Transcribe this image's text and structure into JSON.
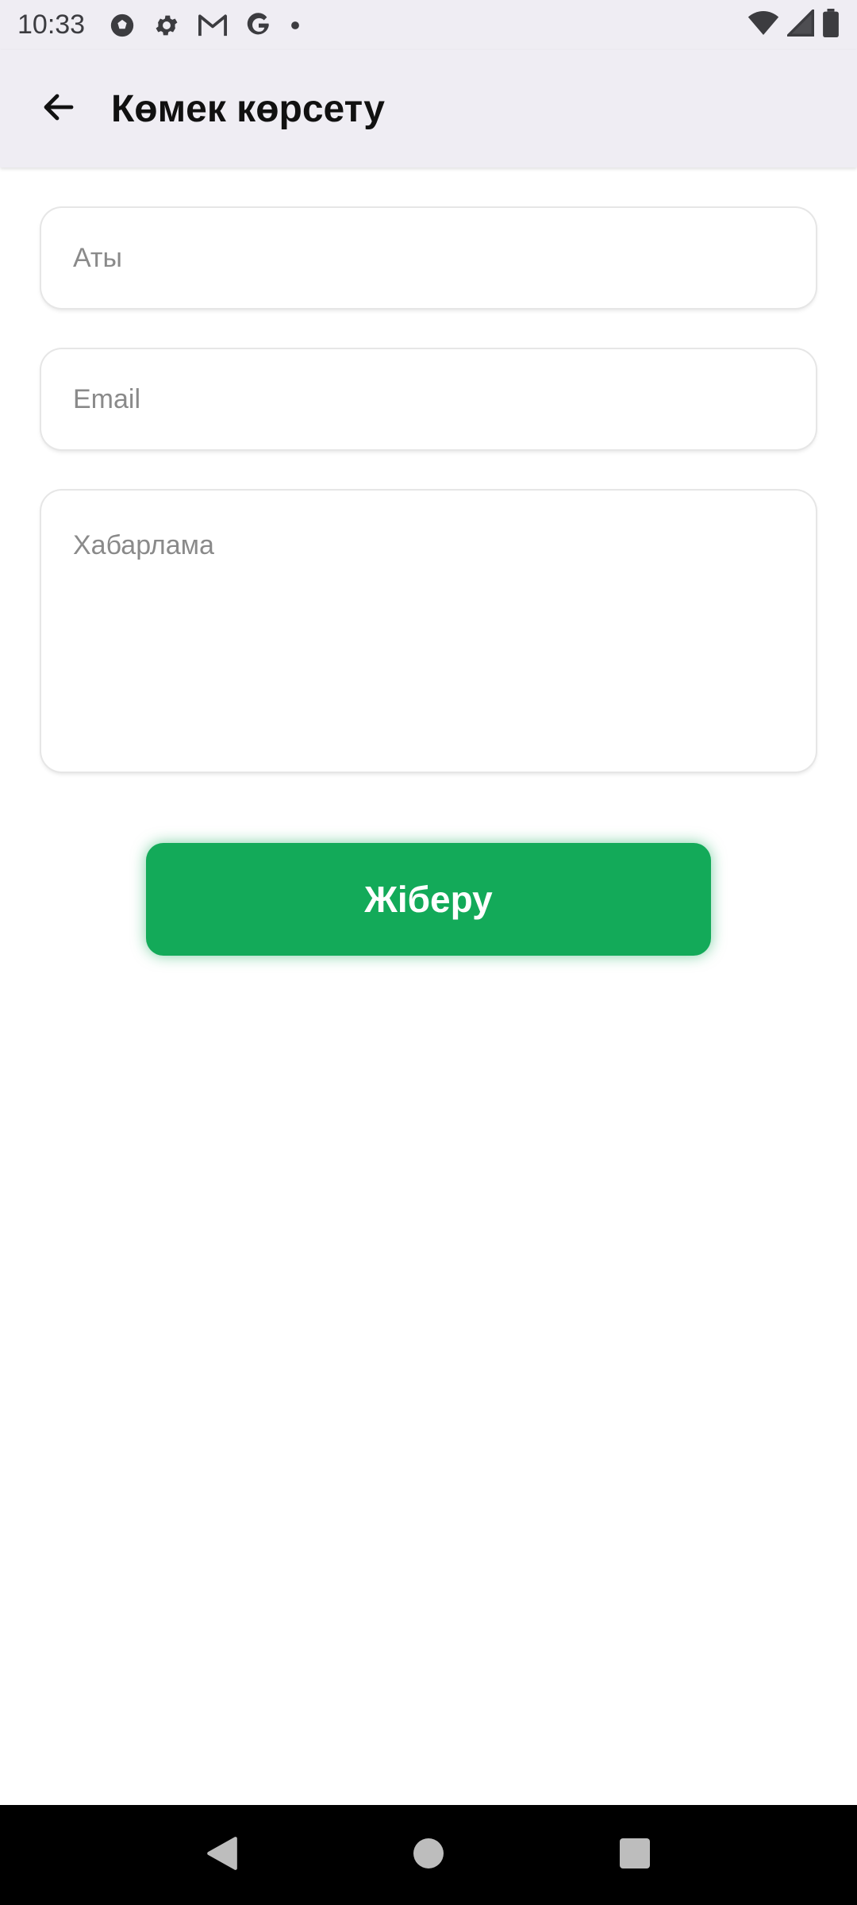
{
  "status_bar": {
    "time": "10:33",
    "icons": [
      "soccer-ball-icon",
      "gear-icon",
      "gmail-icon",
      "google-icon",
      "dot-icon"
    ],
    "right_icons": [
      "wifi-icon",
      "signal-icon",
      "battery-icon"
    ]
  },
  "app_bar": {
    "back_icon": "arrow-left-icon",
    "title": "Көмек көрсету"
  },
  "form": {
    "name_placeholder": "Аты",
    "email_placeholder": "Email",
    "message_placeholder": "Хабарлама",
    "name_value": "",
    "email_value": "",
    "message_value": ""
  },
  "submit": {
    "label": "Жіберу",
    "color": "#13aa59"
  },
  "navigation": {
    "icons": [
      "back-triangle-icon",
      "home-circle-icon",
      "recents-square-icon"
    ]
  }
}
